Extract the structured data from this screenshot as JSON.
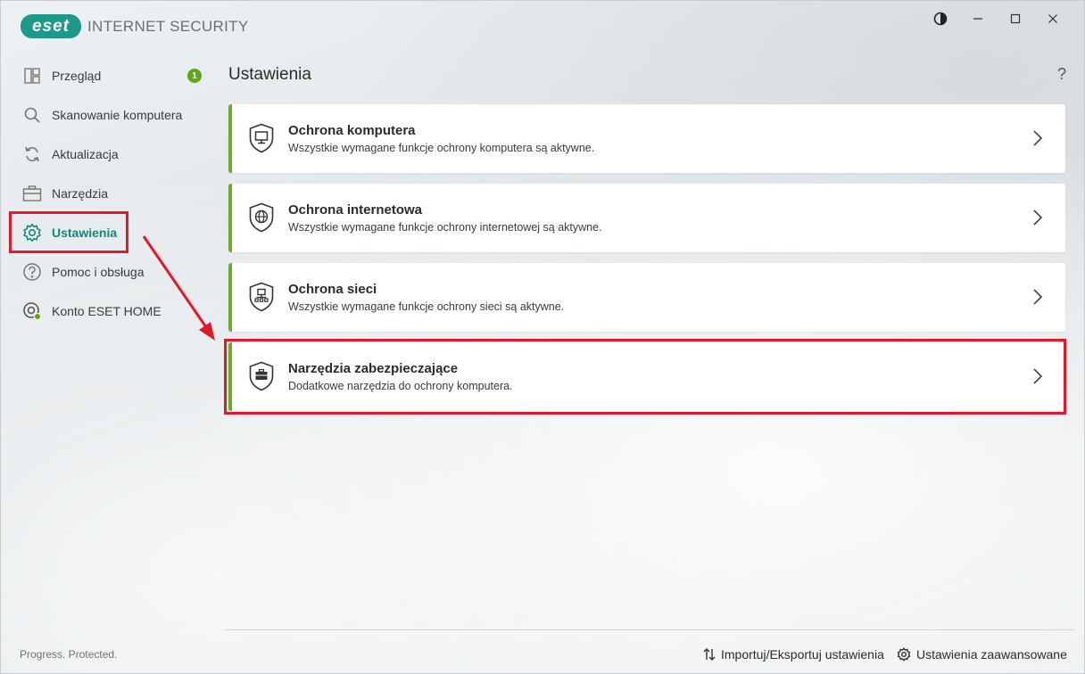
{
  "app": {
    "logo_text": "eset",
    "product_name": "INTERNET SECURITY",
    "tagline": "Progress. Protected."
  },
  "window_controls": {
    "theme_icon": "contrast-icon",
    "minimize_icon": "minimize-icon",
    "maximize_icon": "maximize-icon",
    "close_icon": "close-icon"
  },
  "sidebar": {
    "items": [
      {
        "label": "Przegląd",
        "icon": "overview-icon",
        "badge": "1"
      },
      {
        "label": "Skanowanie komputera",
        "icon": "search-icon"
      },
      {
        "label": "Aktualizacja",
        "icon": "refresh-icon"
      },
      {
        "label": "Narzędzia",
        "icon": "toolbox-icon"
      },
      {
        "label": "Ustawienia",
        "icon": "gear-icon",
        "active": true
      },
      {
        "label": "Pomoc i obsługa",
        "icon": "help-icon"
      },
      {
        "label": "Konto ESET HOME",
        "icon": "account-icon"
      }
    ]
  },
  "main": {
    "title": "Ustawienia",
    "help_label": "?",
    "cards": [
      {
        "title": "Ochrona komputera",
        "description": "Wszystkie wymagane funkcje ochrony komputera są aktywne.",
        "icon": "computer-shield-icon"
      },
      {
        "title": "Ochrona internetowa",
        "description": "Wszystkie wymagane funkcje ochrony internetowej są aktywne.",
        "icon": "globe-shield-icon"
      },
      {
        "title": "Ochrona sieci",
        "description": "Wszystkie wymagane funkcje ochrony sieci są aktywne.",
        "icon": "network-shield-icon"
      },
      {
        "title": "Narzędzia zabezpieczające",
        "description": "Dodatkowe narzędzia do ochrony komputera.",
        "icon": "toolbox-shield-icon"
      }
    ]
  },
  "footer": {
    "import_export_label": "Importuj/Eksportuj ustawienia",
    "advanced_label": "Ustawienia zaawansowane"
  },
  "colors": {
    "accent": "#0e8a7a",
    "logo": "#1b9a8a",
    "status_ok": "#6aab2a",
    "annotation": "#e2182b"
  }
}
